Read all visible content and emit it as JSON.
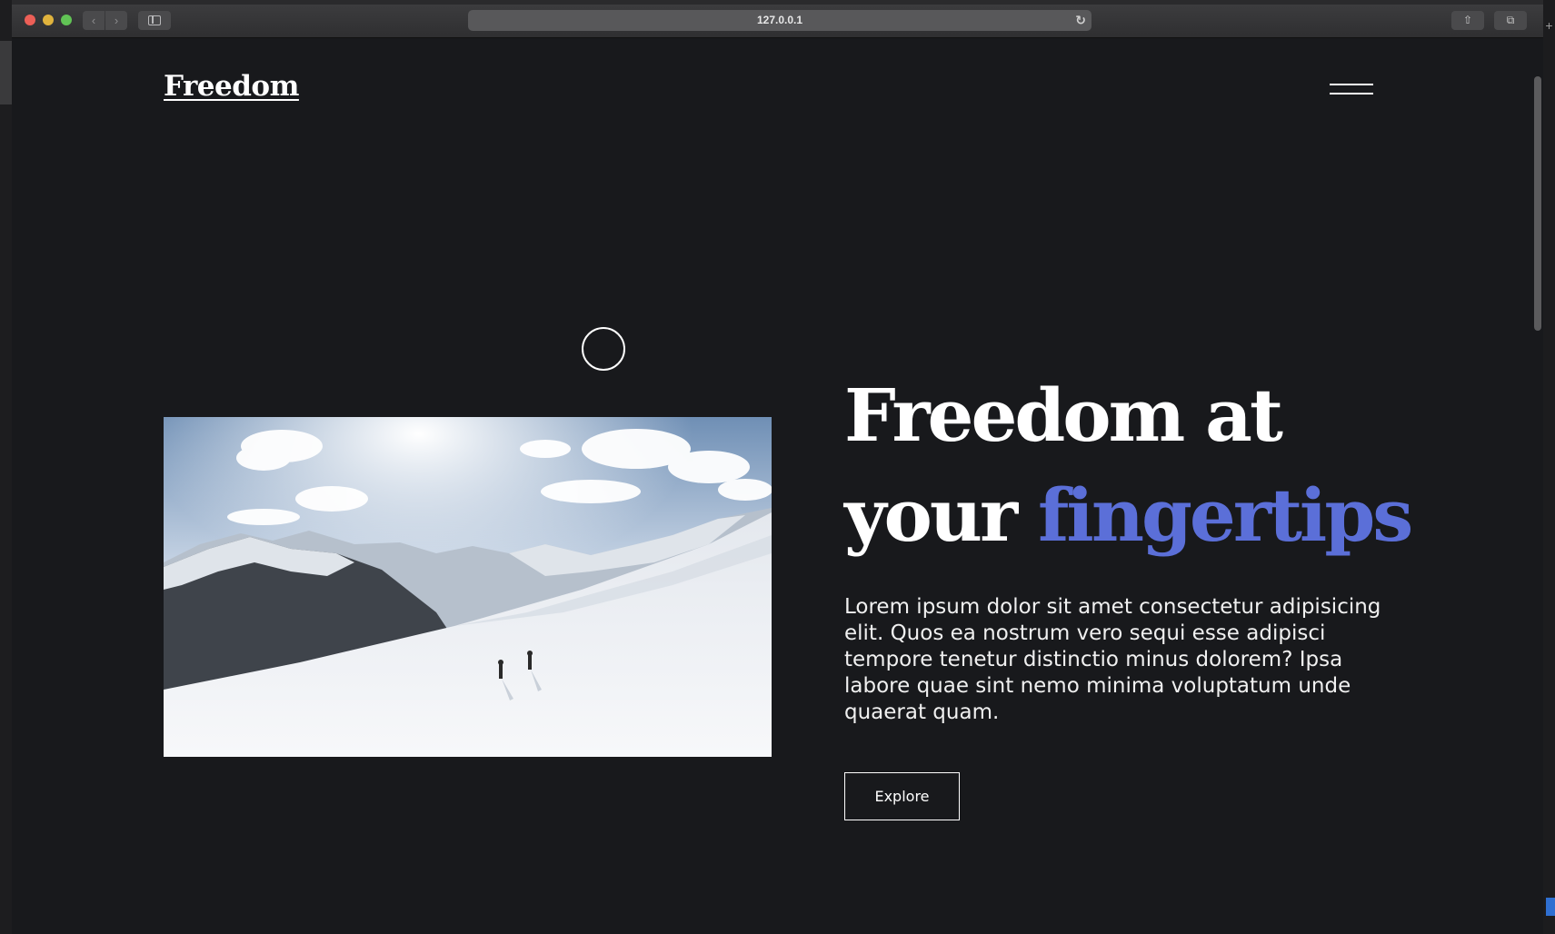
{
  "browser": {
    "url": "127.0.0.1",
    "icons": {
      "back": "chevron-left-icon",
      "forward": "chevron-right-icon",
      "sidebar": "sidebar-icon",
      "reload": "reload-icon",
      "share": "share-icon",
      "tabs": "tabs-icon",
      "new_tab": "plus-icon"
    }
  },
  "header": {
    "logo": "Freedom",
    "menu_icon": "hamburger-menu-icon"
  },
  "hero": {
    "headline_line1": "Freedom at",
    "headline_line2_plain": "your ",
    "headline_line2_accent": "fingertips",
    "body": "Lorem ipsum dolor sit amet consectetur adipisicing elit. Quos ea nostrum vero sequi esse adipisci tempore tenetur distinctio minus dolorem? Ipsa labore quae sint nemo minima voluptatum unde quaerat quam.",
    "cta_label": "Explore",
    "image": "snowy-mountain-hikers-image"
  },
  "colors": {
    "background": "#18191c",
    "accent": "#5b6fd8",
    "text": "#ffffff"
  }
}
